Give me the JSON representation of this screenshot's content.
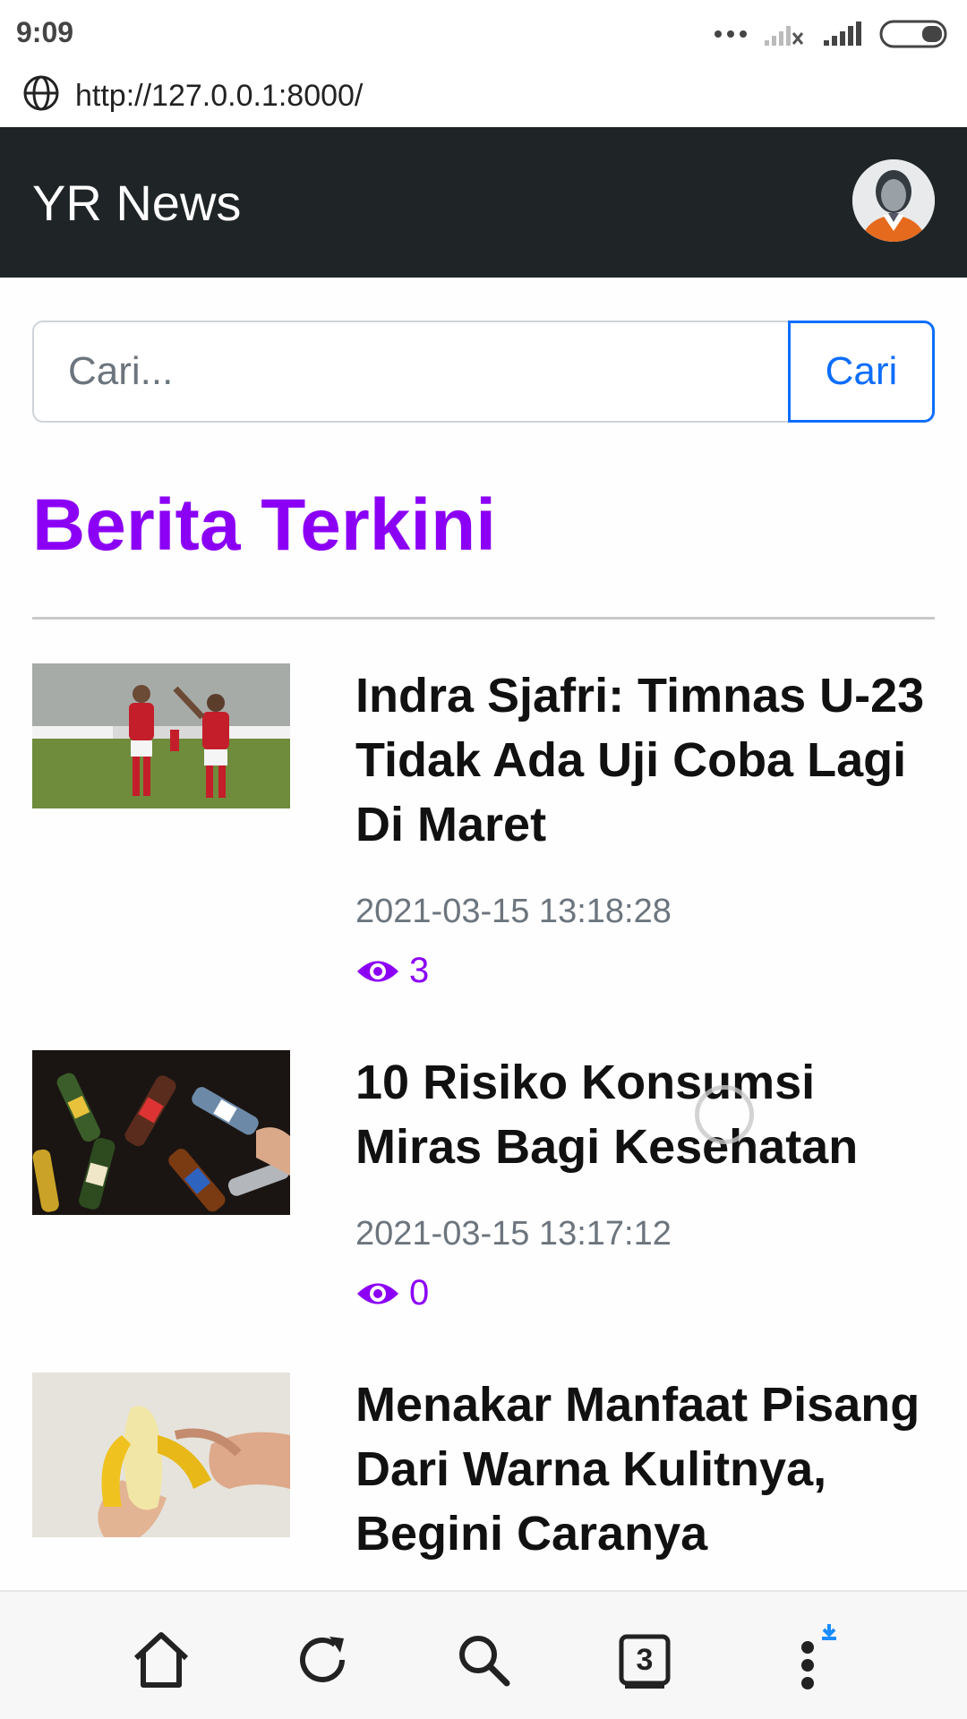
{
  "status_bar": {
    "time": "9:09"
  },
  "browser": {
    "url": "http://127.0.0.1:8000/"
  },
  "navbar": {
    "brand": "YR News"
  },
  "search": {
    "placeholder": "Cari...",
    "button_label": "Cari"
  },
  "section": {
    "title": "Berita Terkini"
  },
  "articles": [
    {
      "title": "Indra Sjafri: Timnas U-23 Tidak Ada Uji Coba Lagi Di Maret",
      "date": "2021-03-15 13:18:28",
      "views": "3"
    },
    {
      "title": "10 Risiko Konsumsi Miras Bagi Kesehatan",
      "date": "2021-03-15 13:17:12",
      "views": "0"
    },
    {
      "title": "Menakar Manfaat Pisang Dari Warna Kulitnya, Begini Caranya"
    }
  ],
  "bottom_nav": {
    "tab_count": "3"
  },
  "colors": {
    "accent": "#8b00f5",
    "navbar": "#1f2527",
    "link_blue": "#0d6efd",
    "muted": "#6c757d"
  }
}
